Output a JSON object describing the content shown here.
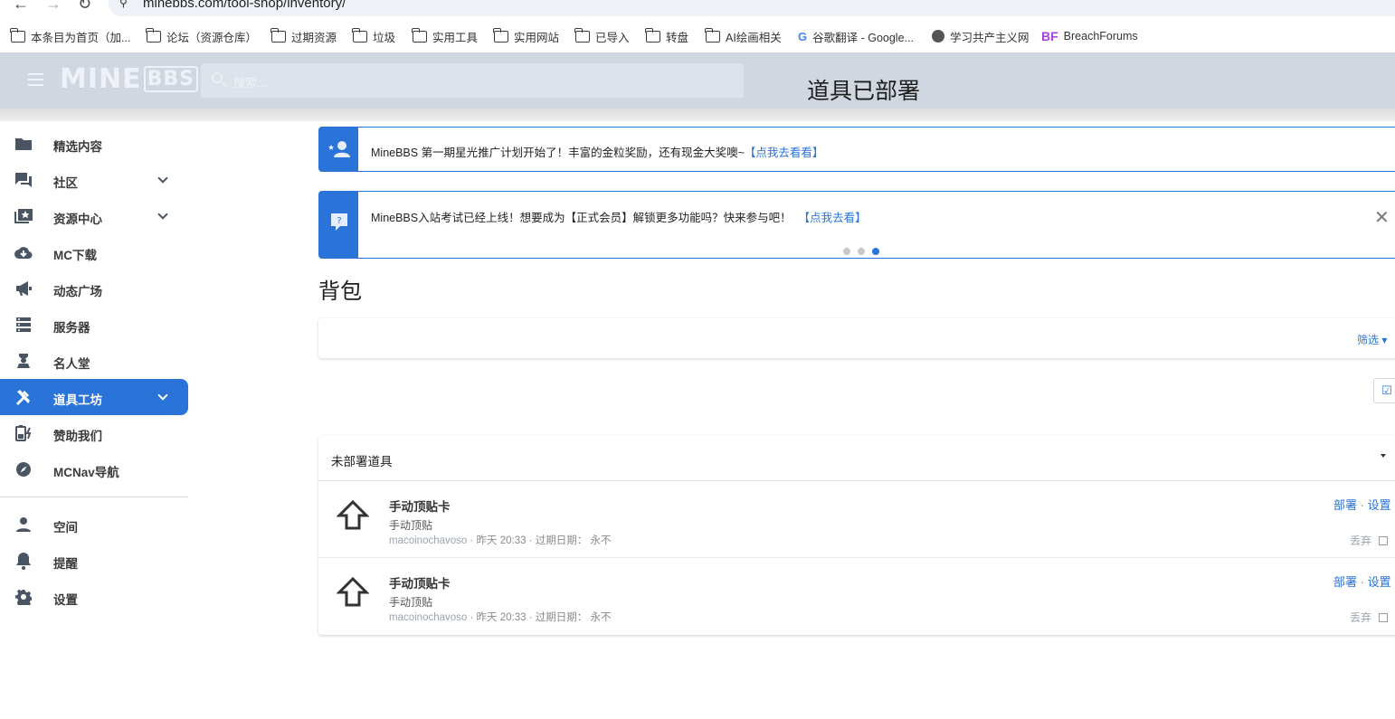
{
  "browser": {
    "url": "minebbs.com/tool-shop/inventory/",
    "bookmarks": [
      {
        "label": "本条目为首页（加...",
        "icon": "folder-icon"
      },
      {
        "label": "论坛（资源仓库）",
        "icon": "folder-icon"
      },
      {
        "label": "过期资源",
        "icon": "folder-icon"
      },
      {
        "label": "垃圾",
        "icon": "folder-icon"
      },
      {
        "label": "实用工具",
        "icon": "folder-icon"
      },
      {
        "label": "实用网站",
        "icon": "folder-icon"
      },
      {
        "label": "已导入",
        "icon": "folder-icon"
      },
      {
        "label": "转盘",
        "icon": "folder-icon"
      },
      {
        "label": "AI绘画相关",
        "icon": "folder-icon"
      },
      {
        "label": "谷歌翻译 - Google...",
        "icon": "google-icon"
      },
      {
        "label": "学习共产主义网",
        "icon": "globe-icon"
      },
      {
        "label": "BreachForums",
        "icon": "bf-icon"
      }
    ],
    "bf_mark": "BF"
  },
  "header": {
    "logo_main": "MINE",
    "logo_sub": "BBS",
    "search_placeholder": "搜索...",
    "title": "道具已部署"
  },
  "sidebar": {
    "items": [
      {
        "label": "精选内容",
        "icon": "folder-icon",
        "has_chevron": false
      },
      {
        "label": "社区",
        "icon": "forum-icon",
        "has_chevron": true
      },
      {
        "label": "资源中心",
        "icon": "resource-star-icon",
        "has_chevron": true
      },
      {
        "label": "MC下载",
        "icon": "cloud-download-icon",
        "has_chevron": false
      },
      {
        "label": "动态广场",
        "icon": "megaphone-icon",
        "has_chevron": false
      },
      {
        "label": "服务器",
        "icon": "server-icon",
        "has_chevron": false
      },
      {
        "label": "名人堂",
        "icon": "hall-of-fame-icon",
        "has_chevron": false
      },
      {
        "label": "道具工坊",
        "icon": "tools-icon",
        "has_chevron": true,
        "active": true
      },
      {
        "label": "赞助我们",
        "icon": "battery-charging-icon",
        "has_chevron": false
      },
      {
        "label": "MCNav导航",
        "icon": "compass-icon",
        "has_chevron": false
      }
    ],
    "user_items": [
      {
        "label": "空间",
        "icon": "user-icon"
      },
      {
        "label": "提醒",
        "icon": "bell-icon"
      },
      {
        "label": "设置",
        "icon": "gear-icon"
      }
    ]
  },
  "notices": [
    {
      "text": "MineBBS 第一期星光推广计划开始了！丰富的金粒奖励，还有现金大奖噢~",
      "link": "【点我去看看】"
    },
    {
      "text": "MineBBS入站考试已经上线！想要成为【正式会员】解锁更多功能吗？快来参与吧！",
      "link": "【点我去看】"
    }
  ],
  "main": {
    "heading": "背包",
    "filter_label": "筛选",
    "block_title": "未部署道具",
    "items": [
      {
        "name": "手动顶贴卡",
        "desc": "手动顶贴",
        "user": "macoinochavoso",
        "time": "昨天 20:33",
        "expiry_label": "过期日期：",
        "expiry": "永不",
        "deploy": "部署",
        "settings": "设置",
        "discard": "丢弃"
      },
      {
        "name": "手动顶贴卡",
        "desc": "手动顶贴",
        "user": "macoinochavoso",
        "time": "昨天 20:33",
        "expiry_label": "过期日期：",
        "expiry": "永不",
        "deploy": "部署",
        "settings": "设置",
        "discard": "丢弃"
      }
    ]
  },
  "colors": {
    "accent": "#2a73d9",
    "header_bg": "#d0d7e1"
  }
}
